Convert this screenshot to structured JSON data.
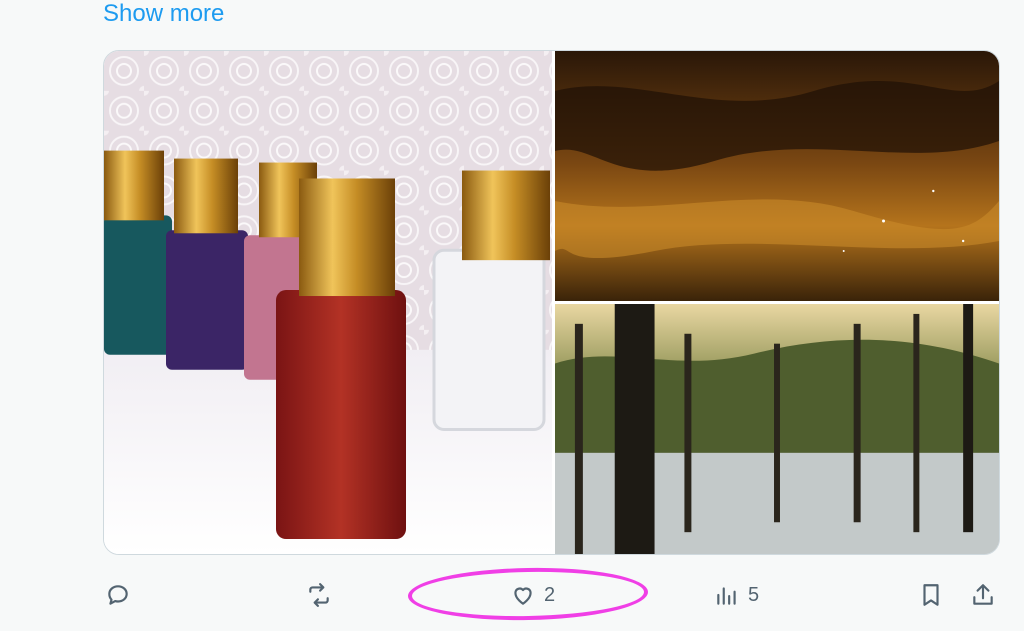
{
  "post": {
    "show_more_label": "Show more"
  },
  "media": {
    "images": [
      "perfume-bottles",
      "night-sky-clouds",
      "misty-dead-trees-lake"
    ]
  },
  "actions": {
    "reply_icon": "reply-icon",
    "retweet_icon": "retweet-icon",
    "like_icon": "heart-icon",
    "like_count": "2",
    "views_icon": "views-icon",
    "views_count": "5",
    "bookmark_icon": "bookmark-icon",
    "share_icon": "share-icon"
  },
  "colors": {
    "link": "#1d9bf0",
    "icon": "#536471",
    "annotation": "#f03fe6"
  }
}
